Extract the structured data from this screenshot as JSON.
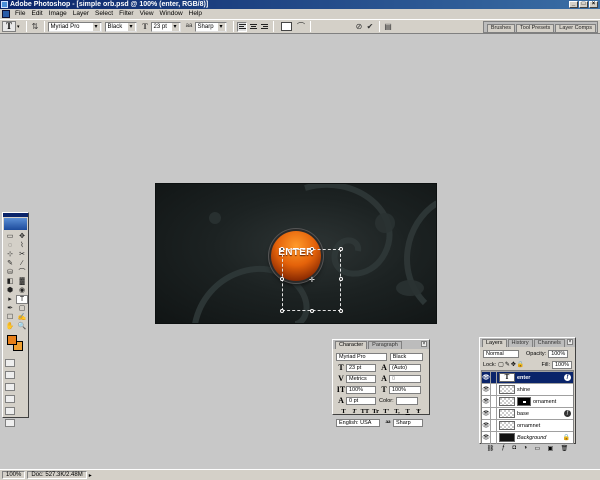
{
  "window": {
    "title": "Adobe Photoshop - [simple orb.psd @ 100% (enter, RGB/8)]",
    "buttons": [
      "_",
      "□",
      "×"
    ]
  },
  "menu": [
    "File",
    "Edit",
    "Image",
    "Layer",
    "Select",
    "Filter",
    "View",
    "Window",
    "Help"
  ],
  "options_bar": {
    "tool_preset": "T",
    "font_family": "Myriad Pro",
    "font_style": "Black",
    "size_icon": "T",
    "font_size": "23 pt",
    "aa_icon": "aa",
    "anti_alias": "Sharp",
    "text_color": "#ffffff",
    "palette_well": [
      "Brushes",
      "Tool Presets",
      "Layer Comps"
    ]
  },
  "canvas": {
    "orb_text": "ENTER",
    "orb_color": "#e4620a"
  },
  "toolbox": {
    "tools": [
      "▭",
      "✥",
      "◌",
      "⌇",
      "⊹",
      "✂",
      "✎",
      "∕",
      "⛁",
      "⌒",
      "◧",
      "▓",
      "⬢",
      "◉",
      "▸",
      "T",
      "✒",
      "▢",
      "☐",
      "✍",
      "✋",
      "🔍"
    ],
    "foreground_color": "#e8801a",
    "background_color": "#f0a030"
  },
  "status": {
    "zoom": "100%",
    "doc_size": "Doc: 527.3K/2.48M"
  },
  "character_panel": {
    "tabs": [
      "Character",
      "Paragraph"
    ],
    "font_family": "Myriad Pro",
    "font_style": "Black",
    "font_size": "23 pt",
    "leading": "(Auto)",
    "kerning": "Metrics",
    "tracking": "0",
    "vertical_scale": "100%",
    "horizontal_scale": "100%",
    "baseline_shift": "0 pt",
    "color_label": "Color:",
    "style_buttons": [
      "T",
      "T",
      "TT",
      "Tr",
      "T'",
      "T,",
      "T",
      "Ŧ"
    ],
    "language": "English: USA",
    "anti_alias": "Sharp"
  },
  "layers_panel": {
    "tabs": [
      "Layers",
      "History",
      "Channels"
    ],
    "blend_mode": "Normal",
    "opacity_label": "Opacity:",
    "opacity": "100%",
    "lock_label": "Lock:",
    "fill_label": "Fill:",
    "fill": "100%",
    "layers": [
      {
        "name": "enter",
        "thumb": "T",
        "selected": true
      },
      {
        "name": "shine",
        "thumb": ""
      },
      {
        "name": "ornament",
        "thumb": ""
      },
      {
        "name": "base",
        "thumb": ""
      },
      {
        "name": "ornamnet",
        "thumb": ""
      },
      {
        "name": "Background",
        "thumb": ""
      }
    ]
  }
}
